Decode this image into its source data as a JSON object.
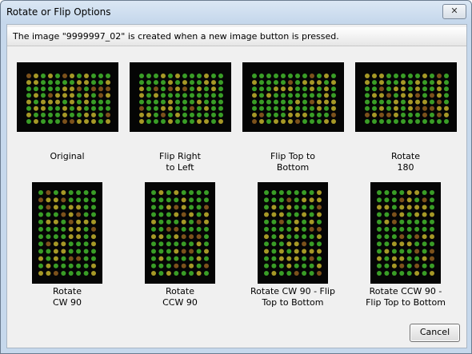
{
  "window": {
    "title": "Rotate or Flip Options",
    "close_glyph": "✕"
  },
  "info": {
    "message": "The image \"9999997_02\" is created when a new image button is pressed."
  },
  "options": [
    {
      "label": "Original",
      "orientation": "landscape"
    },
    {
      "label": "Flip Right\nto Left",
      "orientation": "landscape"
    },
    {
      "label": "Flip Top to\nBottom",
      "orientation": "landscape"
    },
    {
      "label": "Rotate\n180",
      "orientation": "landscape"
    },
    {
      "label": "Rotate\nCW 90",
      "orientation": "portrait"
    },
    {
      "label": "Rotate\nCCW 90",
      "orientation": "portrait"
    },
    {
      "label": "Rotate CW 90 - Flip\nTop to Bottom",
      "orientation": "portrait"
    },
    {
      "label": "Rotate CCW 90 -\nFlip Top to Bottom",
      "orientation": "portrait"
    }
  ],
  "buttons": {
    "cancel": "Cancel"
  },
  "colors": {
    "spot_green": "#3fae2a",
    "spot_yellow": "#b8a82a",
    "spot_red": "#8a5a1e",
    "thumb_bg": "#050505"
  }
}
